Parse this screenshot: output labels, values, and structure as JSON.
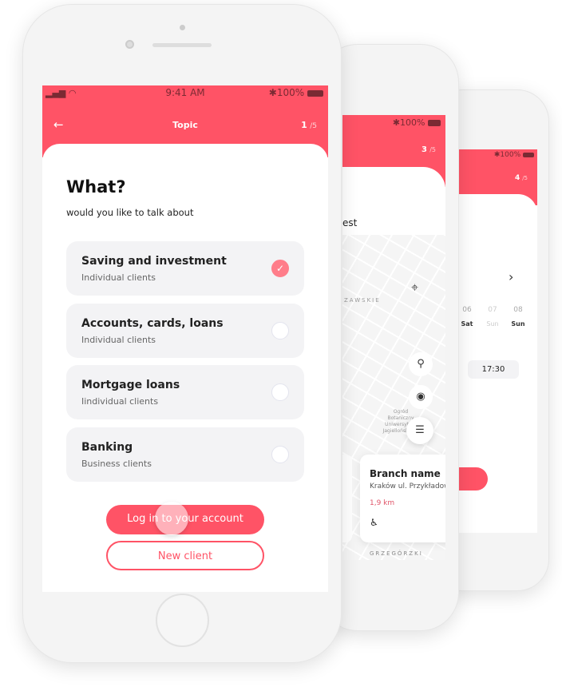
{
  "phone3": {
    "battery": "100%",
    "step": "4",
    "total": "/5",
    "dates": [
      {
        "num": "06",
        "day": "Sat"
      },
      {
        "num": "07",
        "day": "Sun"
      },
      {
        "num": "08",
        "day": "Sun"
      }
    ],
    "time": "17:30"
  },
  "phone2": {
    "battery": "100%",
    "step": "3",
    "total": "/5",
    "title_fragment": "est",
    "district1": "ZAWSKIE",
    "district2": "GRZEGÓRZKI",
    "garden": "Ogród Botaniczny Uniwersytetu Jagiellońskiego",
    "branch": {
      "name": "Branch name",
      "address": "Kraków ul. Przykładowa",
      "distance": "1,9 km"
    }
  },
  "phone1": {
    "status": {
      "time": "9:41 AM",
      "battery": "100%"
    },
    "header": {
      "title": "Topic",
      "step": "1",
      "total": "/5"
    },
    "heading": "What?",
    "subheading": "would you like to talk about",
    "options": [
      {
        "title": "Saving and investment",
        "subtitle": "Individual clients",
        "selected": true
      },
      {
        "title": "Accounts, cards, loans",
        "subtitle": "Individual clients",
        "selected": false
      },
      {
        "title": "Mortgage loans",
        "subtitle": "Iindividual clients",
        "selected": false
      },
      {
        "title": "Banking",
        "subtitle": "Business clients",
        "selected": false
      }
    ],
    "login_label": "Log in to your account",
    "new_client_label": "New client"
  },
  "colors": {
    "accent": "#ff5366",
    "distance": "#e0566a"
  }
}
